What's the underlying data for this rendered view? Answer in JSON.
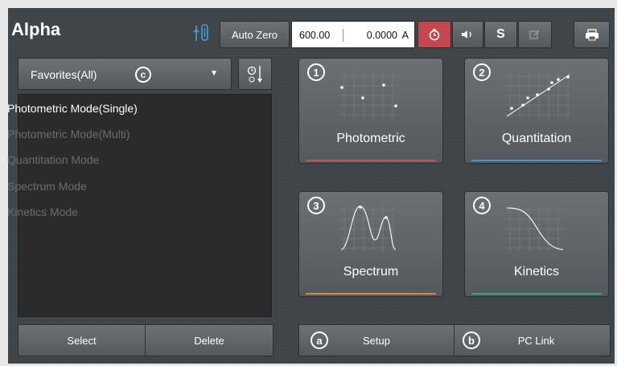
{
  "header": {
    "app_title": "Alpha",
    "auto_zero_label": "Auto Zero",
    "wavelength": "600.00",
    "absorbance": "0.0000",
    "unit": "A",
    "toolbar_icons": [
      "timer-icon",
      "speaker-icon",
      "s-icon",
      "edit-icon",
      "print-icon"
    ],
    "usb_icon": "usb-icon",
    "timer_active_color": "#c4464f"
  },
  "favorites": {
    "dropdown_label": "Favorites(All)",
    "callout": "c",
    "items": [
      {
        "label": "Photometric Mode(Single)",
        "selected": true
      },
      {
        "label": "Photometric Mode(Multi)",
        "selected": false
      },
      {
        "label": "Quantitation Mode",
        "selected": false
      },
      {
        "label": "Spectrum Mode",
        "selected": false
      },
      {
        "label": "Kinetics Mode",
        "selected": false
      }
    ],
    "select_label": "Select",
    "delete_label": "Delete"
  },
  "tiles": [
    {
      "number": "1",
      "label": "Photometric",
      "accent": "#c8545a"
    },
    {
      "number": "2",
      "label": "Quantitation",
      "accent": "#4f90c8"
    },
    {
      "number": "3",
      "label": "Spectrum",
      "accent": "#d2883e"
    },
    {
      "number": "4",
      "label": "Kinetics",
      "accent": "#3fa57a"
    }
  ],
  "bottom": {
    "setup_callout": "a",
    "setup_label": "Setup",
    "pclink_callout": "b",
    "pclink_label": "PC Link"
  }
}
